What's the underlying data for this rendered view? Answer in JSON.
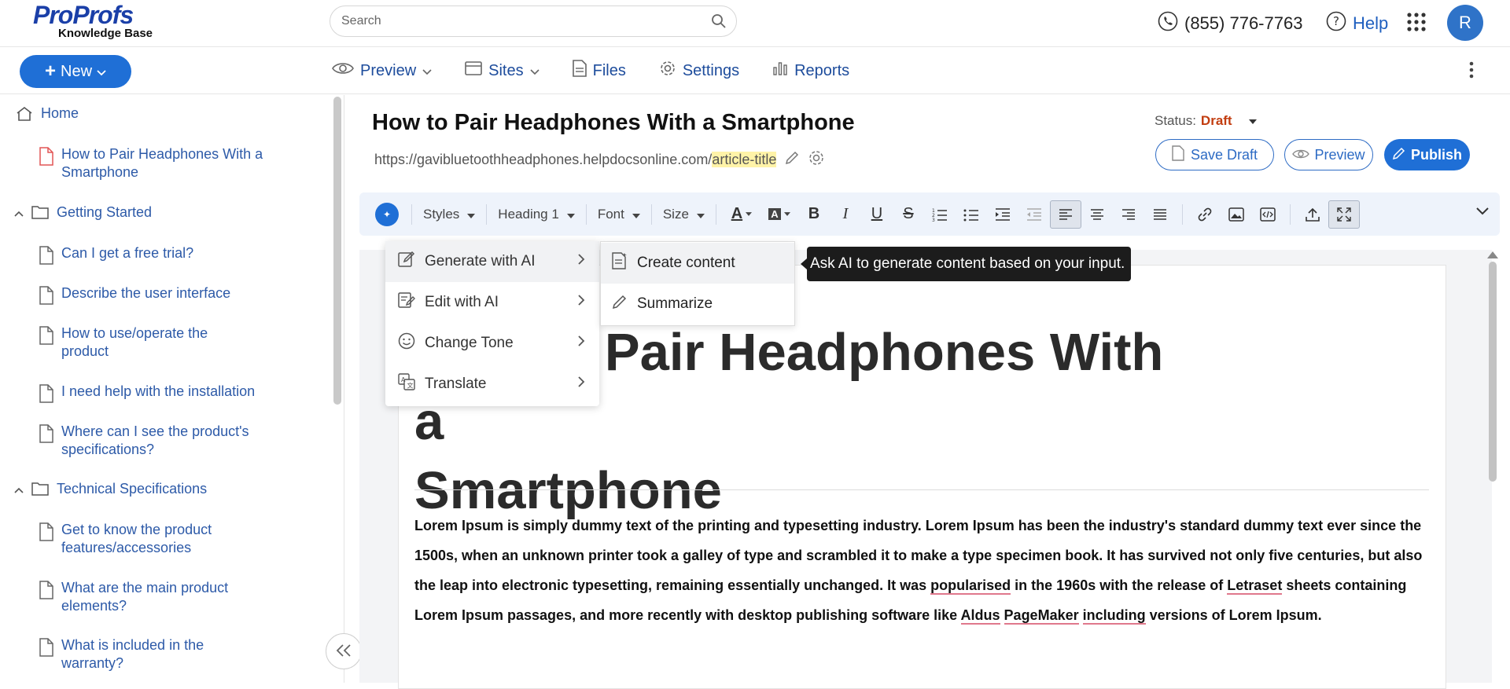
{
  "header": {
    "brand": "ProProfs",
    "brand_sub": "Knowledge Base",
    "search_placeholder": "Search",
    "phone": "(855) 776-7763",
    "help": "Help",
    "avatar_initial": "R"
  },
  "nav": {
    "new_label": "New",
    "items": [
      {
        "label": "Preview",
        "icon": "eye-icon",
        "dropdown": true
      },
      {
        "label": "Sites",
        "icon": "browser-icon",
        "dropdown": true
      },
      {
        "label": "Files",
        "icon": "file-icon",
        "dropdown": false
      },
      {
        "label": "Settings",
        "icon": "gear-icon",
        "dropdown": false
      },
      {
        "label": "Reports",
        "icon": "bar-chart-icon",
        "dropdown": false
      }
    ]
  },
  "sidebar": {
    "home": "Home",
    "current_article": "How to Pair Headphones With a Smartphone",
    "sections": [
      {
        "title": "Getting Started",
        "items": [
          "Can I get a free trial?",
          "Describe the user interface",
          "How to use/operate the product",
          "I need help with the installation",
          "Where can I see the product's specifications?"
        ]
      },
      {
        "title": "Technical Specifications",
        "items": [
          "Get to know the product features/accessories",
          "What are the main product elements?",
          "What is included in the warranty?"
        ]
      }
    ]
  },
  "article": {
    "title": "How to Pair Headphones With a Smartphone",
    "url_base": "https://gavibluetoothheadphones.helpdocsonline.com/",
    "url_slug": "article-title",
    "status_label": "Status:",
    "status_value": "Draft",
    "save_draft": "Save Draft",
    "preview": "Preview",
    "publish": "Publish",
    "heading_line1": "How to Pair Headphones With a",
    "heading_line2": "Smartphone",
    "body": {
      "p1": "Lorem Ipsum is simply dummy text of the printing and typesetting industry. Lorem Ipsum has been the industry's standard dummy text ever since the 1500s, when an unknown printer took a galley of type and scrambled it to make a type specimen book. It has survived not only five centuries, but also the leap into electronic typesetting, remaining essentially unchanged. It was ",
      "w1": "popularised",
      "p2": " in the 1960s with the release of ",
      "w2": "Letraset",
      "p3": " sheets containing Lorem Ipsum passages, and more recently with desktop publishing software like ",
      "w3": "Aldus",
      "p4": " ",
      "w4": "PageMaker",
      "p5": " ",
      "w5": "including",
      "p6": " versions of Lorem Ipsum."
    }
  },
  "toolbar": {
    "styles": "Styles",
    "heading": "Heading 1",
    "font": "Font",
    "size": "Size"
  },
  "ai_menu": {
    "items": [
      {
        "label": "Generate with AI",
        "icon": "ai-edit-icon"
      },
      {
        "label": "Edit with AI",
        "icon": "document-edit-icon"
      },
      {
        "label": "Change Tone",
        "icon": "smiley-icon"
      },
      {
        "label": "Translate",
        "icon": "translate-icon"
      }
    ],
    "submenu": [
      {
        "label": "Create content",
        "icon": "create-content-icon"
      },
      {
        "label": "Summarize",
        "icon": "pencil-icon"
      }
    ],
    "tooltip": "Ask AI to generate content based on your input."
  },
  "colors": {
    "primary": "#1f6fd6",
    "link": "#2d5aa8",
    "draft": "#c23d10"
  }
}
